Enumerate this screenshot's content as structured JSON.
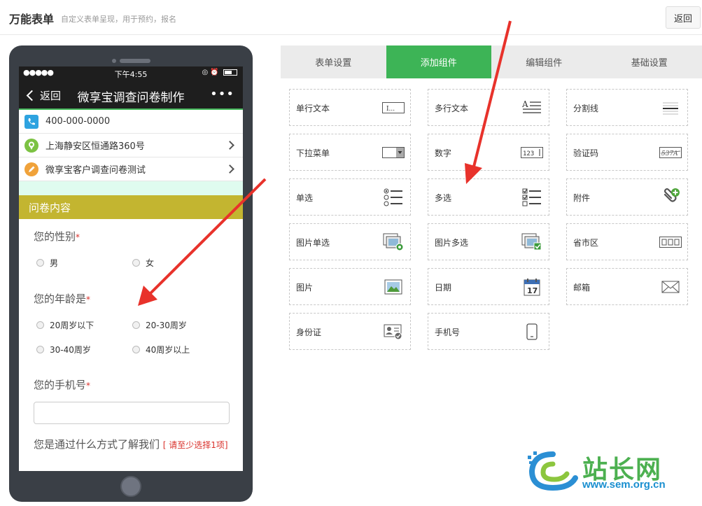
{
  "header": {
    "title": "万能表单",
    "subtitle": "自定义表单呈现，用于预约，报名",
    "back_label": "返回"
  },
  "phone": {
    "status": {
      "signal": "●●●●●",
      "time": "下午4:55"
    },
    "nav": {
      "back_label": "返回",
      "title": "微享宝调查问卷制作",
      "more": "•••"
    },
    "info": {
      "phone": "400-000-0000",
      "address": "上海静安区恒通路360号",
      "survey": "微享宝客户调查问卷测试"
    },
    "section_title": "问卷内容",
    "q_gender": {
      "label": "您的性别",
      "req": "*",
      "options": [
        "男",
        "女"
      ]
    },
    "q_age": {
      "label": "您的年龄是",
      "req": "*",
      "options": [
        "20周岁以下",
        "20-30周岁",
        "30-40周岁",
        "40周岁以上"
      ]
    },
    "q_phone": {
      "label": "您的手机号",
      "req": "*"
    },
    "q_source": {
      "label": "您是通过什么方式了解我们",
      "hint": "[ 请至少选择1项]"
    }
  },
  "tabs": [
    {
      "label": "表单设置",
      "active": false
    },
    {
      "label": "添加组件",
      "active": true
    },
    {
      "label": "编辑组件",
      "active": false
    },
    {
      "label": "基础设置",
      "active": false
    }
  ],
  "components": [
    {
      "label": "单行文本",
      "icon": "single-line-text-icon"
    },
    {
      "label": "多行文本",
      "icon": "multi-line-text-icon"
    },
    {
      "label": "分割线",
      "icon": "divider-icon"
    },
    {
      "label": "下拉菜单",
      "icon": "dropdown-icon"
    },
    {
      "label": "数字",
      "icon": "number-icon"
    },
    {
      "label": "验证码",
      "icon": "captcha-icon"
    },
    {
      "label": "单选",
      "icon": "single-choice-icon"
    },
    {
      "label": "多选",
      "icon": "multi-choice-icon"
    },
    {
      "label": "附件",
      "icon": "attachment-icon"
    },
    {
      "label": "图片单选",
      "icon": "image-single-choice-icon"
    },
    {
      "label": "图片多选",
      "icon": "image-multi-choice-icon"
    },
    {
      "label": "省市区",
      "icon": "region-icon"
    },
    {
      "label": "图片",
      "icon": "image-icon"
    },
    {
      "label": "日期",
      "icon": "calendar-icon"
    },
    {
      "label": "邮箱",
      "icon": "email-icon"
    },
    {
      "label": "身份证",
      "icon": "id-card-icon"
    },
    {
      "label": "手机号",
      "icon": "mobile-phone-icon"
    }
  ],
  "icon_text": {
    "number": "123",
    "captcha": "537A",
    "calendar": "17",
    "single_line": "I..."
  },
  "watermark": {
    "text": "站长网",
    "url": "www.sem.org.cn"
  },
  "colors": {
    "accent_green": "#3db456",
    "section_bar": "#c3b530",
    "arrow_red": "#e8322b"
  }
}
